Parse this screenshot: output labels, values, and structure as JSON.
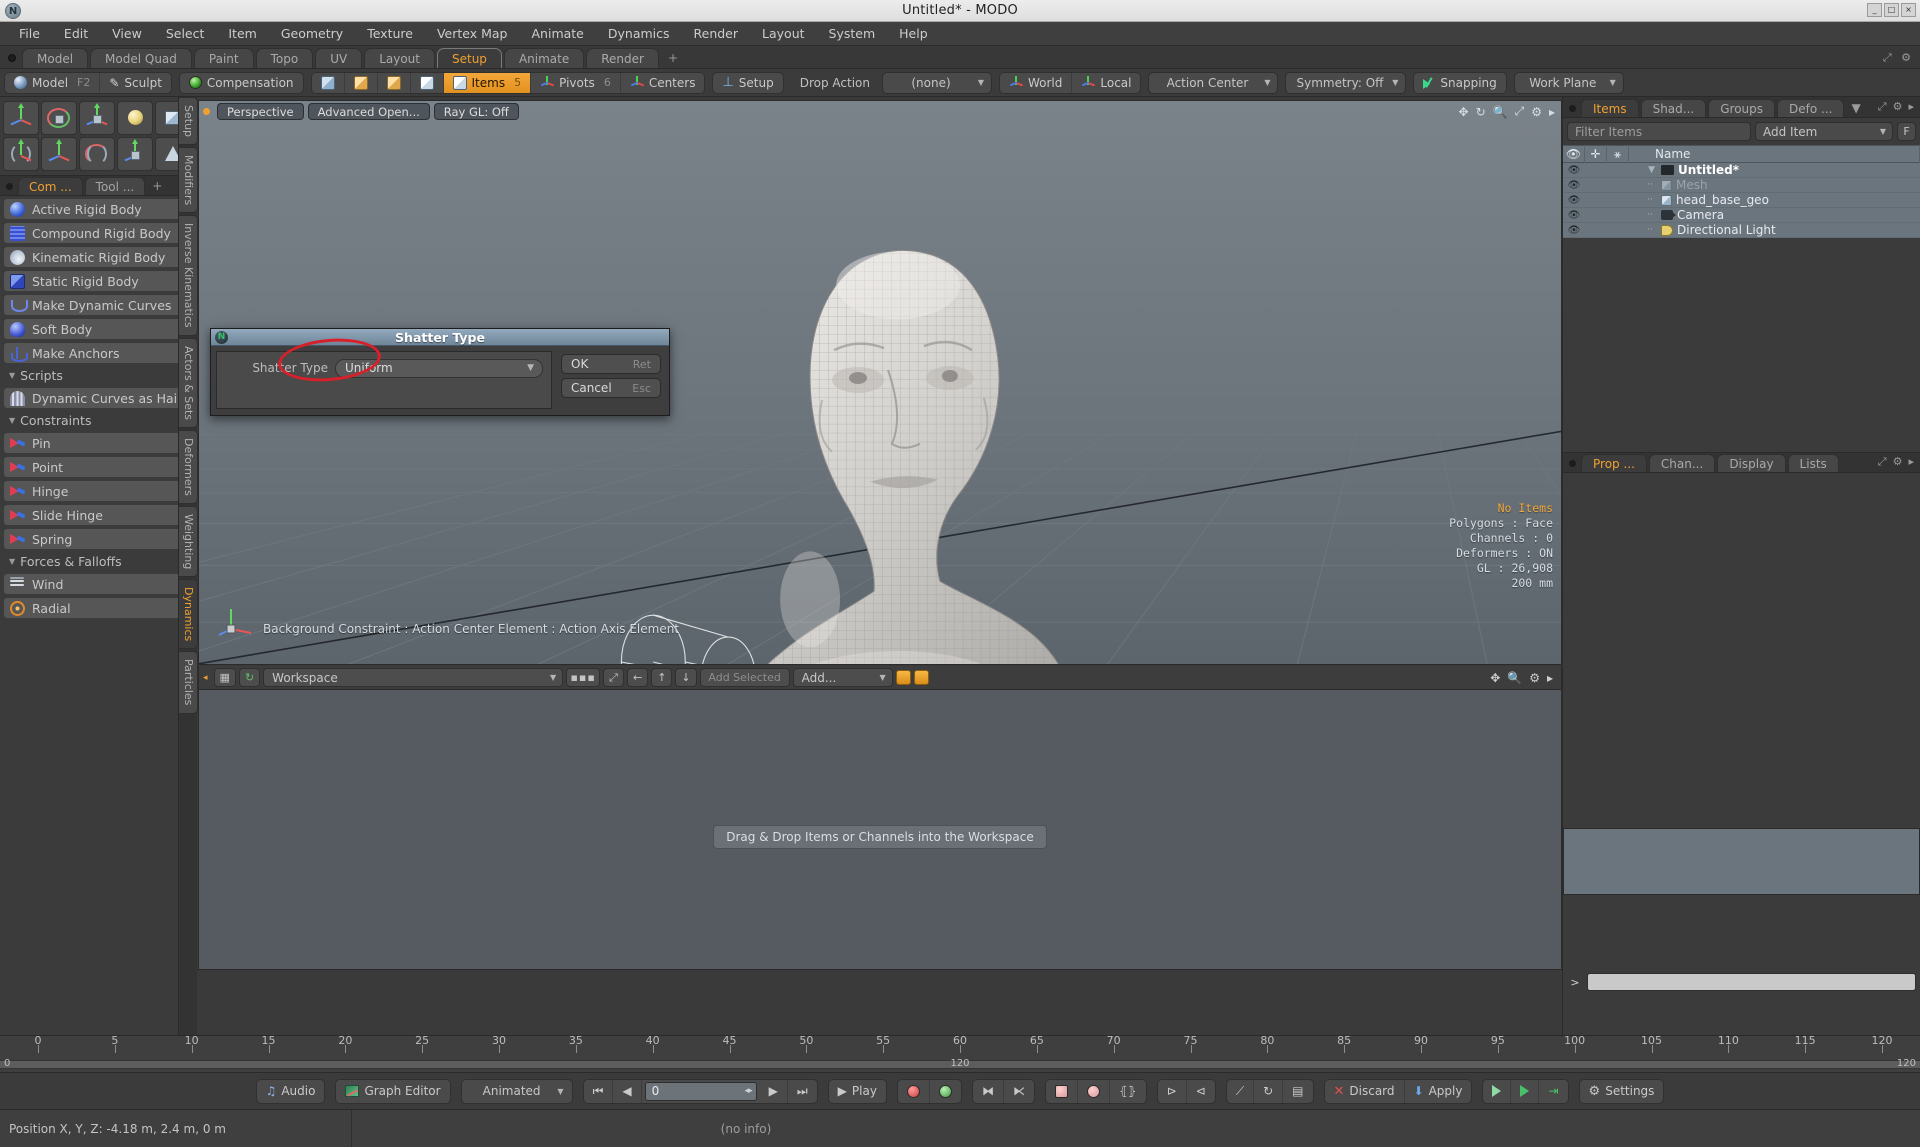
{
  "window": {
    "title": "Untitled* - MODO",
    "min_label": "_",
    "max_label": "□",
    "close_label": "×",
    "logo_glyph": "N"
  },
  "menubar": {
    "items": [
      "File",
      "Edit",
      "View",
      "Select",
      "Item",
      "Geometry",
      "Texture",
      "Vertex Map",
      "Animate",
      "Dynamics",
      "Render",
      "Layout",
      "System",
      "Help"
    ]
  },
  "layout_tabs": {
    "items": [
      "Model",
      "Model Quad",
      "Paint",
      "Topo",
      "UV",
      "Layout",
      "Setup",
      "Animate",
      "Render"
    ],
    "active": "Setup",
    "add_label": "+"
  },
  "toolbar": {
    "mode_model": "Model",
    "mode_model_key": "F2",
    "mode_sculpt": "Sculpt",
    "compensation": "Compensation",
    "items_label": "Items",
    "items_key": "5",
    "pivots_label": "Pivots",
    "pivots_key": "6",
    "centers_label": "Centers",
    "setup_label": "Setup",
    "drop_action_label": "Drop Action",
    "drop_action_value": "(none)",
    "world_label": "World",
    "local_label": "Local",
    "action_center": "Action Center",
    "symmetry": "Symmetry: Off",
    "snapping": "Snapping",
    "work_plane": "Work Plane"
  },
  "left_panel": {
    "tabs": {
      "items": [
        "Com ...",
        "Tool ..."
      ],
      "active": "Com ...",
      "add": "+"
    },
    "vertical_tabs": [
      "Setup",
      "Modifiers",
      "Inverse Kinematics",
      "Actors & Sets",
      "Deformers",
      "Weighting",
      "Dynamics",
      "Particles"
    ],
    "vertical_active": "Dynamics",
    "groups": [
      {
        "header": null,
        "items": [
          {
            "label": "Active Rigid Body",
            "icon": "blue-sphere-icon"
          },
          {
            "label": "Compound Rigid Body",
            "icon": "grid-cube-icon"
          },
          {
            "label": "Kinematic Rigid Body",
            "icon": "white-sphere-icon"
          },
          {
            "label": "Static Rigid Body",
            "icon": "blue-cube-icon"
          },
          {
            "label": "Make Dynamic Curves",
            "icon": "curve-icon"
          }
        ]
      },
      {
        "header": null,
        "items": [
          {
            "label": "Soft Body",
            "icon": "soft-body-icon"
          }
        ]
      },
      {
        "header": null,
        "items": [
          {
            "label": "Make Anchors",
            "icon": "anchor-icon"
          }
        ]
      },
      {
        "header": "Scripts",
        "items": [
          {
            "label": "Dynamic Curves as Hair",
            "icon": "hair-icon"
          }
        ]
      },
      {
        "header": "Constraints",
        "items": [
          {
            "label": "Pin",
            "icon": "pin-icon"
          },
          {
            "label": "Point",
            "icon": "point-icon"
          },
          {
            "label": "Hinge",
            "icon": "hinge-icon"
          },
          {
            "label": "Slide Hinge",
            "icon": "slide-hinge-icon"
          },
          {
            "label": "Spring",
            "icon": "spring-icon"
          }
        ]
      },
      {
        "header": "Forces & Falloffs",
        "items": [
          {
            "label": "Wind",
            "icon": "wind-icon"
          },
          {
            "label": "Radial",
            "icon": "radial-icon"
          }
        ]
      }
    ]
  },
  "viewport": {
    "chips": [
      "Perspective",
      "Advanced Open...",
      "Ray GL: Off"
    ],
    "info": {
      "selection": "No Items",
      "polygons": "Polygons : Face",
      "channels": "Channels : 0",
      "deformers": "Deformers : ON",
      "gl": "GL : 26,908",
      "scale": "200 mm"
    },
    "footer": "Background Constraint  :  Action Center Element  :  Action Axis Element"
  },
  "dialog": {
    "title": "Shatter Type",
    "field_label": "Shatter Type",
    "field_value": "Uniform",
    "ok_label": "OK",
    "ok_key": "Ret",
    "cancel_label": "Cancel",
    "cancel_key": "Esc"
  },
  "workspace_bar": {
    "preset": "Workspace",
    "add_selected": "Add Selected",
    "add": "Add..."
  },
  "workspace": {
    "hint": "Drag & Drop Items or Channels into the Workspace"
  },
  "right_panel": {
    "tabs": [
      "Items",
      "Shad...",
      "Groups",
      "Defo ..."
    ],
    "active_tab": "Items",
    "filter_placeholder": "Filter Items",
    "add_item": "Add Item",
    "f_button": "F",
    "columns": [
      "",
      "",
      "",
      "Name"
    ],
    "tree": [
      {
        "name": "Untitled*",
        "icon": "scene-icon",
        "level": 0,
        "dim": false,
        "root": true
      },
      {
        "name": "Mesh",
        "icon": "mesh-icon",
        "level": 1,
        "dim": true,
        "root": false
      },
      {
        "name": "head_base_geo",
        "icon": "mesh-icon",
        "level": 1,
        "dim": false,
        "root": false
      },
      {
        "name": "Camera",
        "icon": "camera-icon",
        "level": 1,
        "dim": false,
        "root": false
      },
      {
        "name": "Directional Light",
        "icon": "light-icon",
        "level": 1,
        "dim": false,
        "root": false
      }
    ],
    "lower_tabs": [
      "Prop ...",
      "Chan...",
      "Display",
      "Lists"
    ],
    "lower_active": "Prop ..."
  },
  "timeline": {
    "ticks": [
      0,
      5,
      10,
      15,
      20,
      25,
      30,
      35,
      40,
      45,
      50,
      55,
      60,
      65,
      70,
      75,
      80,
      85,
      90,
      95,
      100,
      105,
      110,
      115,
      120
    ],
    "range_start": "0",
    "range_end": "120",
    "range_center": "120"
  },
  "playbar": {
    "audio": "Audio",
    "graph_editor": "Graph Editor",
    "mode": "Animated",
    "frame": "0",
    "play": "Play",
    "discard": "Discard",
    "apply": "Apply",
    "settings": "Settings"
  },
  "statusbar": {
    "position": "Position X, Y, Z:   -4.18 m, 2.4 m, 0 m",
    "info": "(no info)"
  }
}
